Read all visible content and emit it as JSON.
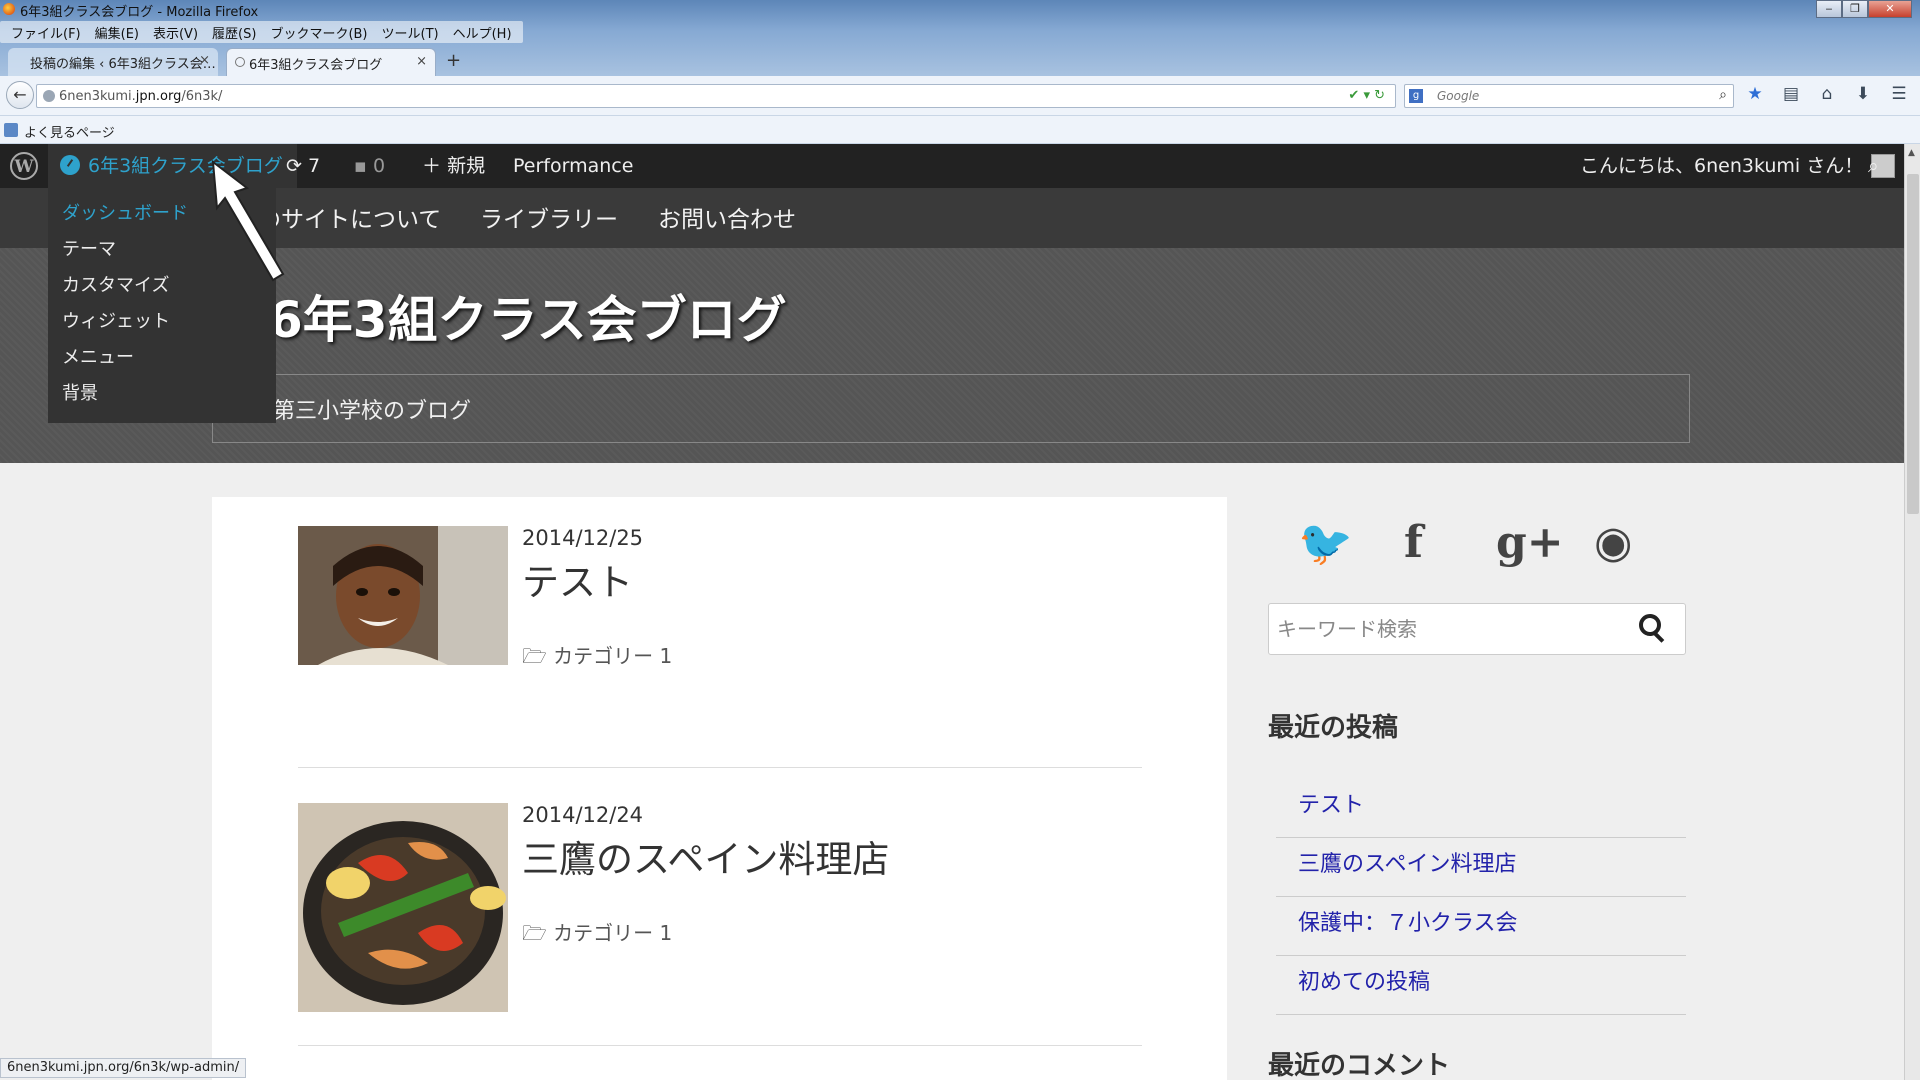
{
  "window": {
    "title": "6年3組クラス会ブログ - Mozilla Firefox",
    "menus": [
      "ファイル(F)",
      "編集(E)",
      "表示(V)",
      "履歴(S)",
      "ブックマーク(B)",
      "ツール(T)",
      "ヘルプ(H)"
    ]
  },
  "tabs": [
    {
      "label": "投稿の編集 ‹ 6年3組クラス会…",
      "close": "×"
    },
    {
      "label": "6年3組クラス会ブログ",
      "close": "×"
    }
  ],
  "new_tab": "+",
  "address_bar": {
    "host": "6nen3kumi.",
    "domain": "jpn.org",
    "path": "/6n3k/"
  },
  "search_bar": {
    "placeholder": "Google"
  },
  "bookmarks": {
    "label": "よく見るページ"
  },
  "admin_bar": {
    "site_name": "6年3組クラス会ブログ",
    "updates_count": "7",
    "comments_count": "0",
    "new_label": "新規",
    "performance_label": "Performance",
    "greeting": "こんにちは、6nen3kumi さん！"
  },
  "dropdown": {
    "items": [
      "ダッシュボード",
      "テーマ",
      "カスタマイズ",
      "ウィジェット",
      "メニュー",
      "背景"
    ]
  },
  "theme_nav": {
    "items": [
      "のサイトについて",
      "ライブラリー",
      "お問い合わせ"
    ]
  },
  "site": {
    "title": "6年3組クラス会ブログ",
    "description": "第三小学校のブログ"
  },
  "posts": [
    {
      "date": "2014/12/25",
      "title": "テスト",
      "category": "カテゴリー 1"
    },
    {
      "date": "2014/12/24",
      "title": "三鷹のスペイン料理店",
      "category": "カテゴリー 1"
    }
  ],
  "sidebar": {
    "search_placeholder": "キーワード検索",
    "recent_posts_title": "最近の投稿",
    "recent_posts": [
      "テスト",
      "三鷹のスペイン料理店",
      "保護中：７小クラス会",
      "初めての投稿"
    ],
    "recent_comments_title": "最近のコメント"
  },
  "status_bar": {
    "text": "6nen3kumi.jpn.org/6n3k/wp-admin/"
  }
}
